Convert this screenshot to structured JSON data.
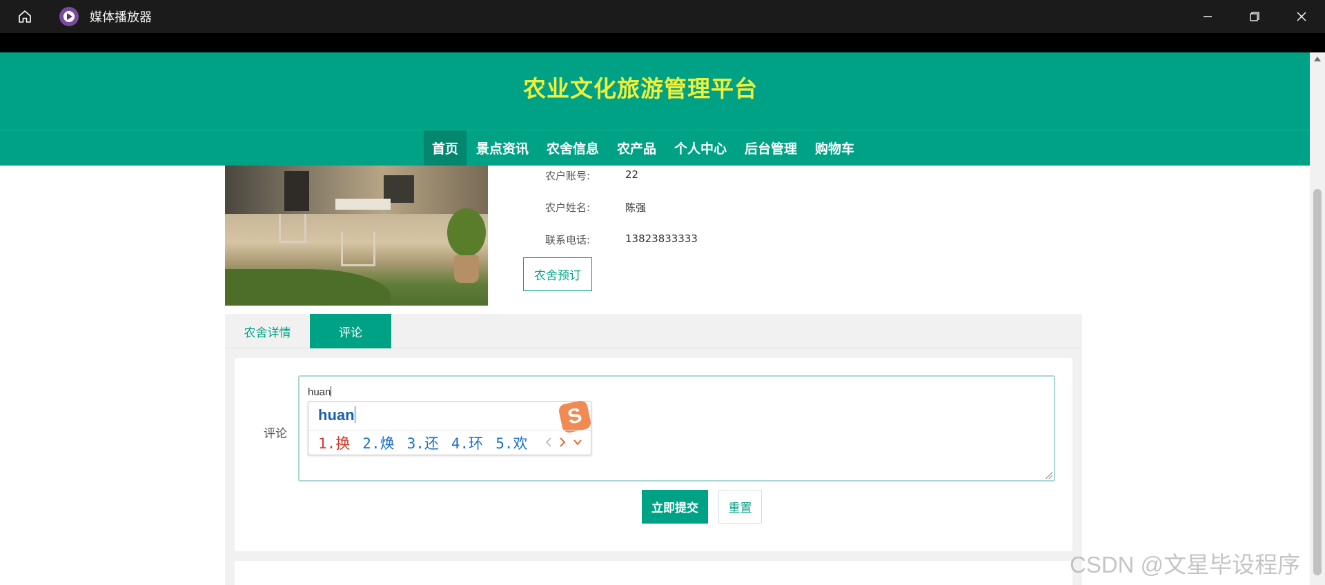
{
  "window": {
    "app_title": "媒体播放器"
  },
  "site": {
    "title": "农业文化旅游管理平台",
    "nav": [
      "首页",
      "景点资讯",
      "农舍信息",
      "农产品",
      "个人中心",
      "后台管理",
      "购物车"
    ],
    "active_nav": "首页"
  },
  "farmhouse": {
    "fields": [
      {
        "label": "农户账号:",
        "value": "22"
      },
      {
        "label": "农户姓名:",
        "value": "陈强"
      },
      {
        "label": "联系电话:",
        "value": "13823833333"
      }
    ],
    "book_button": "农舍预订"
  },
  "tabs": [
    {
      "label": "农舍详情",
      "active": false
    },
    {
      "label": "评论",
      "active": true
    }
  ],
  "comment": {
    "label": "评论",
    "value": "huan",
    "submit": "立即提交",
    "reset": "重置"
  },
  "ime": {
    "composition": "huan",
    "candidates": [
      "1.换",
      "2.焕",
      "3.还",
      "4.环",
      "5.欢"
    ],
    "logo": "S"
  },
  "watermark": "CSDN @文星毕设程序",
  "colors": {
    "primary": "#00a286",
    "title": "#f0f03a",
    "titlebar": "#1b1b1b"
  }
}
